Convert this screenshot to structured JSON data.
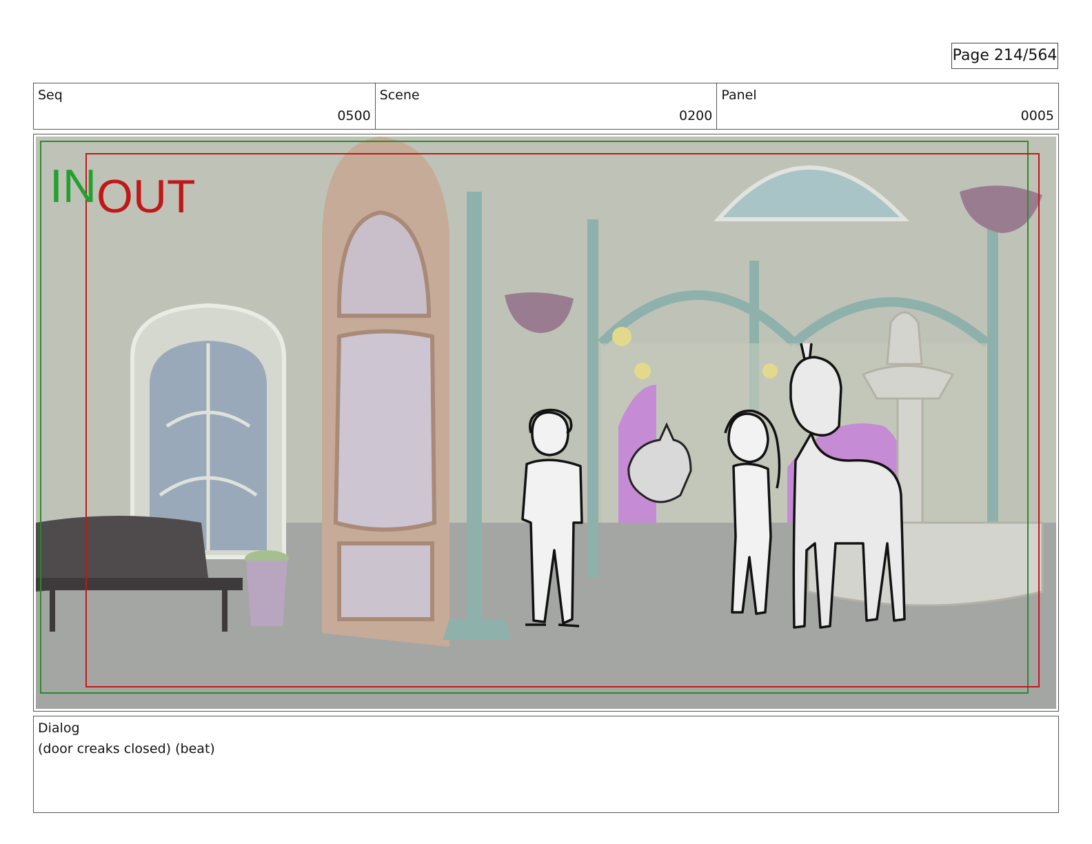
{
  "page": {
    "counter": "Page 214/564"
  },
  "header": {
    "seq": {
      "label": "Seq",
      "value": "0500"
    },
    "scene": {
      "label": "Scene",
      "value": "0200"
    },
    "panel": {
      "label": "Panel",
      "value": "0005"
    }
  },
  "frame_markers": {
    "in_label": "IN",
    "out_label": "OUT",
    "in_color": "#22a030",
    "out_color": "#c01818"
  },
  "dialog": {
    "label": "Dialog",
    "text": "(door creaks closed) (beat)"
  }
}
